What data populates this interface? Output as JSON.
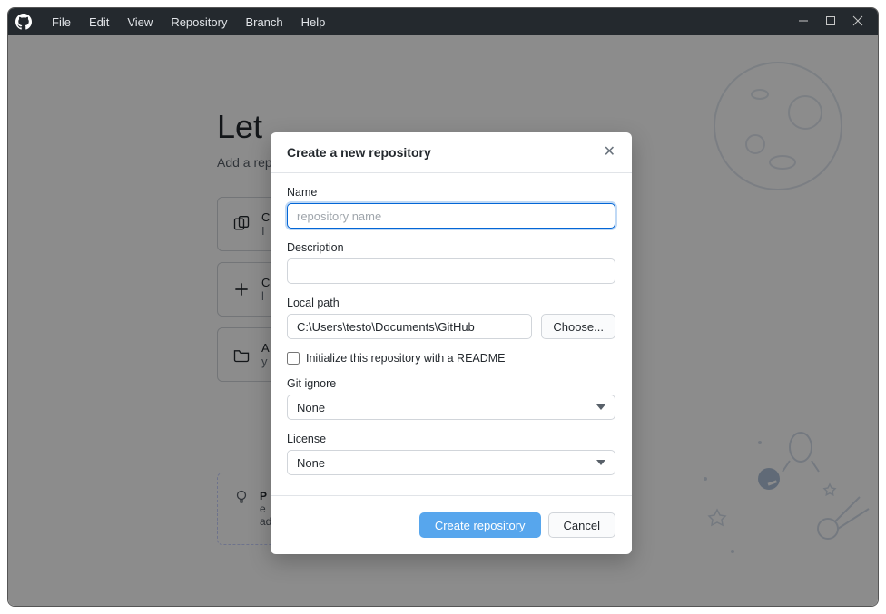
{
  "menu": {
    "items": [
      "File",
      "Edit",
      "View",
      "Repository",
      "Branch",
      "Help"
    ]
  },
  "welcome": {
    "title": "Let",
    "subtitle": "Add a repo",
    "actions": [
      {
        "line1": "C",
        "line2": "I"
      },
      {
        "line1": "C",
        "line2": "l"
      },
      {
        "line1": "A",
        "line2": "y"
      }
    ],
    "tip_strong": "P",
    "tip_line2": "e",
    "tip_line3": "add it to Desktop"
  },
  "dialog": {
    "title": "Create a new repository",
    "name_label": "Name",
    "name_placeholder": "repository name",
    "name_value": "",
    "desc_label": "Description",
    "desc_value": "",
    "path_label": "Local path",
    "path_value": "C:\\Users\\testo\\Documents\\GitHub",
    "choose_label": "Choose...",
    "readme_label": "Initialize this repository with a README",
    "gitignore_label": "Git ignore",
    "gitignore_value": "None",
    "license_label": "License",
    "license_value": "None",
    "create_btn": "Create repository",
    "cancel_btn": "Cancel"
  }
}
